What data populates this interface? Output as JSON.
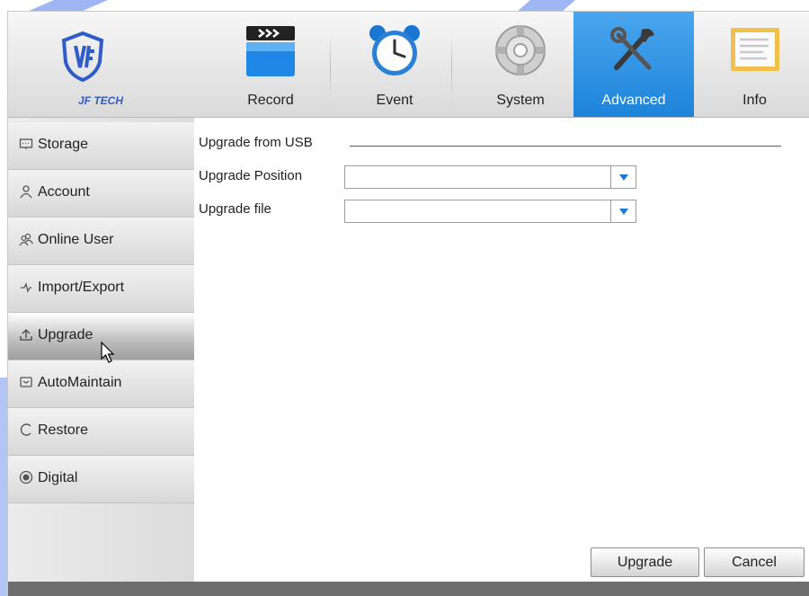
{
  "logo": {
    "text": "JF TECH",
    "icon": "jf-tech-shield-logo"
  },
  "tabs": [
    {
      "label": "Record",
      "icon": "clapperboard-icon",
      "active": false
    },
    {
      "label": "Event",
      "icon": "alarm-clock-icon",
      "active": false
    },
    {
      "label": "System",
      "icon": "gear-icon",
      "active": false
    },
    {
      "label": "Advanced",
      "icon": "tools-icon",
      "active": true
    },
    {
      "label": "Info",
      "icon": "info-screen-icon",
      "active": false
    }
  ],
  "sidebar": {
    "items": [
      {
        "label": "Storage",
        "icon": "storage-icon",
        "selected": false
      },
      {
        "label": "Account",
        "icon": "person-icon",
        "selected": false
      },
      {
        "label": "Online User",
        "icon": "users-icon",
        "selected": false
      },
      {
        "label": "Import/Export",
        "icon": "import-export-icon",
        "selected": false
      },
      {
        "label": "Upgrade",
        "icon": "upload-icon",
        "selected": true
      },
      {
        "label": "AutoMaintain",
        "icon": "maintain-icon",
        "selected": false
      },
      {
        "label": "Restore",
        "icon": "restore-icon",
        "selected": false
      },
      {
        "label": "Digital",
        "icon": "radio-dot-icon",
        "selected": false
      }
    ]
  },
  "main": {
    "section_title": "Upgrade from USB",
    "fields": [
      {
        "label": "Upgrade Position",
        "value": ""
      },
      {
        "label": "Upgrade file",
        "value": ""
      }
    ],
    "buttons": {
      "upgrade": "Upgrade",
      "cancel": "Cancel"
    }
  },
  "colors": {
    "accent": "#1d84da",
    "watermark": "#2e5fe6"
  }
}
